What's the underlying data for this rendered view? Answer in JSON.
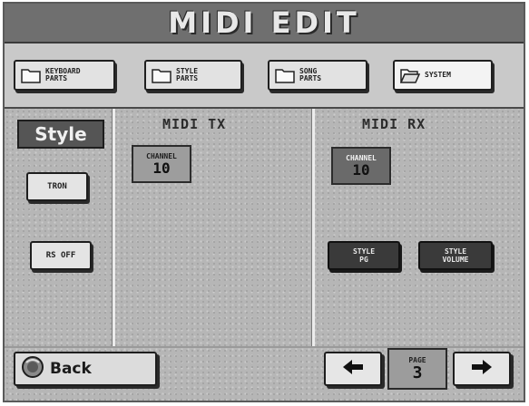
{
  "title": "MIDI EDIT",
  "tabs": [
    {
      "label": "KEYBOARD\nPARTS",
      "icon": "folder-icon",
      "active": false
    },
    {
      "label": "STYLE\nPARTS",
      "icon": "folder-icon",
      "active": false
    },
    {
      "label": "SONG\nPARTS",
      "icon": "folder-icon",
      "active": false
    },
    {
      "label": "SYSTEM",
      "icon": "open-folder-icon",
      "active": true
    }
  ],
  "style_panel": {
    "label": "Style",
    "buttons": [
      "TRON",
      "RS OFF"
    ]
  },
  "midi_tx": {
    "heading": "MIDI TX",
    "channel_label": "CHANNEL",
    "channel_value": "10"
  },
  "midi_rx": {
    "heading": "MIDI RX",
    "channel_label": "CHANNEL",
    "channel_value": "10",
    "buttons": [
      "STYLE\nPG",
      "STYLE\nVOLUME"
    ]
  },
  "footer": {
    "back_label": "Back",
    "page_label": "PAGE",
    "page_value": "3",
    "prev_icon": "arrow-left-icon",
    "next_icon": "arrow-right-icon"
  },
  "colors": {
    "title_bar": "#6f6f6f",
    "panel": "#b6b6b6",
    "dark_button": "#3a3a3a"
  }
}
